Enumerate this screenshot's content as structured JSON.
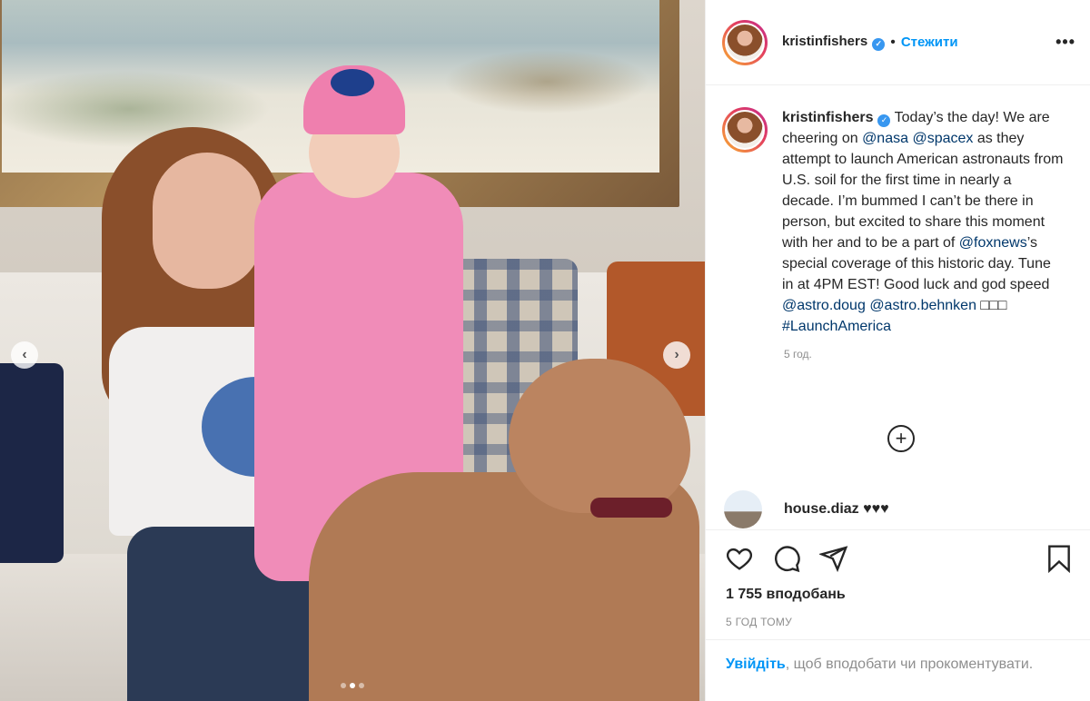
{
  "post": {
    "username": "kristinfishers",
    "separator": "•",
    "follow_label": "Стежити",
    "more_label": "•••",
    "caption": {
      "part1": " Today’s the day! We are cheering on ",
      "mention_nasa": "@nasa",
      "mention_spacex": "@spacex",
      "part2": " as they attempt to launch American astronauts from U.S. soil for the first time in nearly a decade. I’m bummed I can’t be there in person, but excited to share this moment with her and to be a part of ",
      "mention_foxnews": "@foxnews",
      "part3": "’s special coverage of this historic day. Tune in at 4PM EST! Good luck and god speed ",
      "mention_doug": "@astro.doug",
      "mention_behnken": "@astro.behnken",
      "emojis": " □□□ ",
      "hashtag": "#LaunchAmerica"
    },
    "caption_time": "5 год.",
    "load_more_label": "+",
    "comment": {
      "username": "house.diaz",
      "text": " ♥♥♥"
    },
    "likes_label": "1 755 вподобань",
    "time_ago": "5 ГОД ТОМУ",
    "login_link": "Увійдіть",
    "login_rest": ", щоб вподобати чи прокоментувати."
  },
  "carousel": {
    "prev_label": "‹",
    "next_label": "›",
    "current_index": 2,
    "total": 3
  },
  "colors": {
    "accent": "#0095f6",
    "link": "#00376b",
    "verified": "#3897f0"
  },
  "icons": [
    "heart-icon",
    "comment-icon",
    "share-icon",
    "bookmark-icon",
    "verified-icon",
    "add-circle-icon"
  ]
}
